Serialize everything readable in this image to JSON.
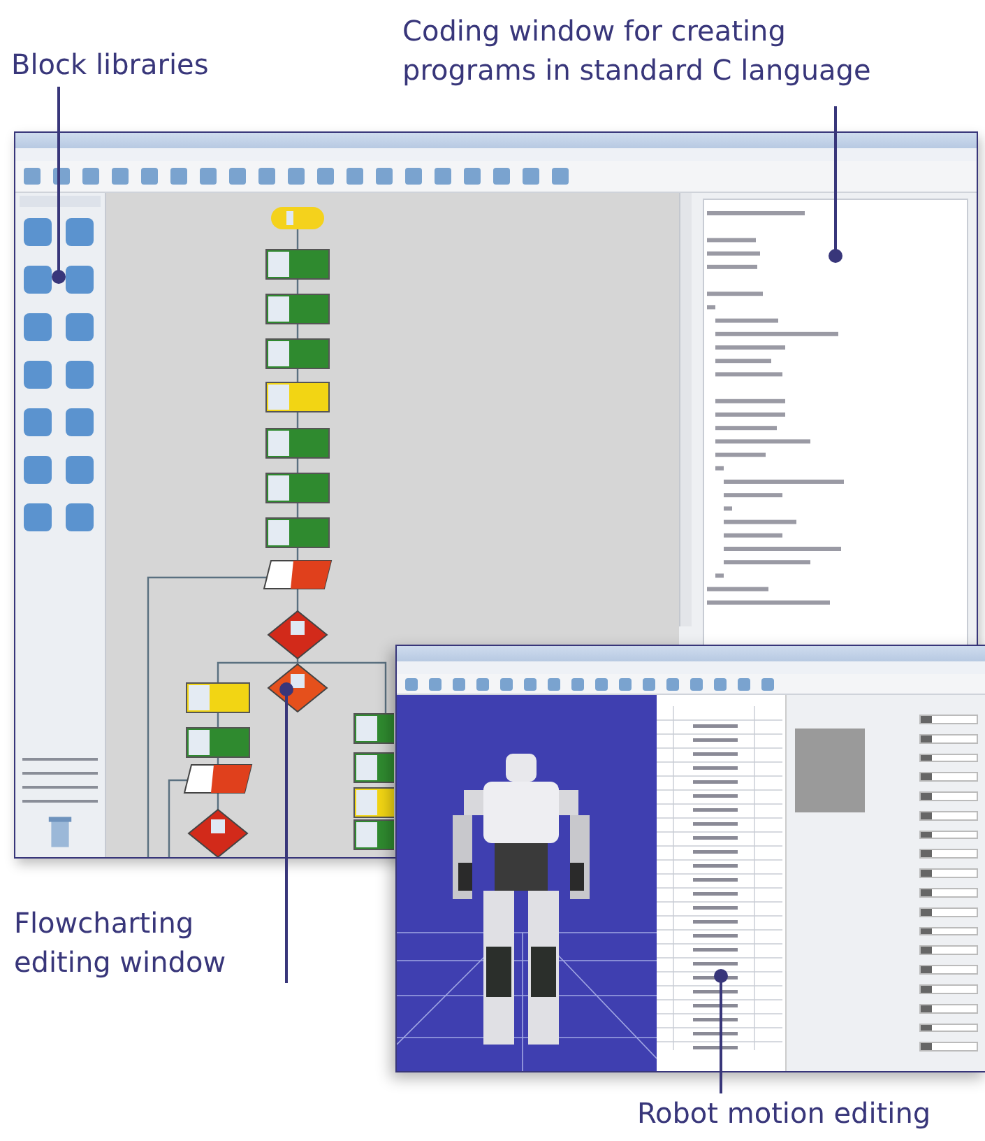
{
  "callouts": [
    {
      "kind": "libraries",
      "lines": [
        "Block libraries"
      ]
    },
    {
      "kind": "coding",
      "lines": [
        "Coding window for creating",
        "programs in standard C language"
      ]
    },
    {
      "kind": "flowchart",
      "lines": [
        "Flowcharting",
        "editing window"
      ]
    },
    {
      "kind": "motion",
      "lines": [
        "Robot motion editing"
      ]
    }
  ],
  "flowchart": {
    "main": [
      {
        "kind": "start"
      },
      {
        "kind": "action"
      },
      {
        "kind": "action"
      },
      {
        "kind": "action"
      },
      {
        "kind": "call"
      },
      {
        "kind": "action"
      },
      {
        "kind": "action"
      },
      {
        "kind": "action"
      },
      {
        "kind": "output"
      },
      {
        "kind": "decision"
      },
      {
        "kind": "branch"
      }
    ],
    "left_branch": [
      {
        "kind": "call"
      },
      {
        "kind": "action"
      },
      {
        "kind": "output"
      },
      {
        "kind": "decision"
      }
    ],
    "right_branch": [
      {
        "kind": "action"
      },
      {
        "kind": "action"
      },
      {
        "kind": "call"
      },
      {
        "kind": "action"
      }
    ]
  }
}
